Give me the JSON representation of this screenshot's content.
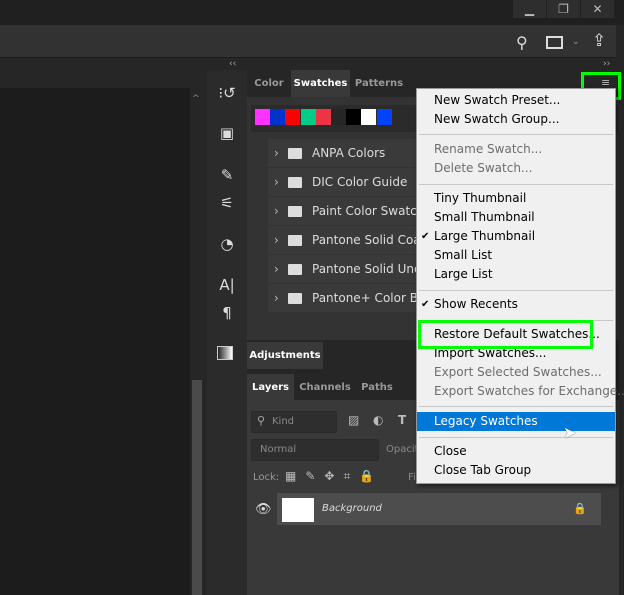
{
  "window": {
    "minimize_icon": "minimize-icon",
    "restore_icon": "restore-icon",
    "close_icon": "close-icon"
  },
  "options_bar": {
    "search_icon": "search-icon",
    "workspace_icon": "workspace-icon",
    "share_icon": "share-icon"
  },
  "panel_collapse": {
    "left": "‹‹",
    "right": "››"
  },
  "swatches_panel": {
    "tabs": [
      {
        "label": "Color"
      },
      {
        "label": "Swatches",
        "active": true
      },
      {
        "label": "Patterns"
      }
    ],
    "menu_icon": "hamburger-icon",
    "recent_swatches": [
      "#ff33ff",
      "#0033cc",
      "#ff0000",
      "#00cc88",
      "#ee3344",
      "#262626",
      "#000000",
      "#ffffff",
      "#0044ff"
    ],
    "groups": [
      {
        "label": "ANPA Colors"
      },
      {
        "label": "DIC Color Guide"
      },
      {
        "label": "Paint Color Swatches"
      },
      {
        "label": "Pantone Solid Coated"
      },
      {
        "label": "Pantone Solid Uncoated"
      },
      {
        "label": "Pantone+ Color Bridge"
      }
    ]
  },
  "adjustments": {
    "label": "Adjustments"
  },
  "layers_panel": {
    "tabs": [
      {
        "label": "Layers",
        "active": true
      },
      {
        "label": "Channels"
      },
      {
        "label": "Paths"
      }
    ],
    "kind": "Kind",
    "blend_mode": "Normal",
    "opacity_label": "Opacity:",
    "lock_label": "Lock:",
    "fill_label": "Fill:",
    "layers": [
      {
        "name": "Background",
        "visible": true,
        "locked": true
      }
    ]
  },
  "menu": {
    "items": [
      {
        "label": "New Swatch Preset..."
      },
      {
        "label": "New Swatch Group..."
      },
      {
        "label": "Rename Swatch...",
        "disabled": true
      },
      {
        "label": "Delete Swatch...",
        "disabled": true
      },
      {
        "label": "Tiny Thumbnail"
      },
      {
        "label": "Small Thumbnail"
      },
      {
        "label": "Large Thumbnail",
        "checked": true
      },
      {
        "label": "Small List"
      },
      {
        "label": "Large List"
      },
      {
        "label": "Show Recents",
        "checked": true
      },
      {
        "label": "Restore Default Swatches..."
      },
      {
        "label": "Import Swatches..."
      },
      {
        "label": "Export Selected Swatches...",
        "disabled": true
      },
      {
        "label": "Export Swatches for Exchange...",
        "disabled": true
      },
      {
        "label": "Legacy Swatches",
        "highlighted": true
      },
      {
        "label": "Close"
      },
      {
        "label": "Close Tab Group"
      }
    ],
    "check": "✔"
  },
  "highlight_color": "#00ff00",
  "selection_color": "#0078d7"
}
